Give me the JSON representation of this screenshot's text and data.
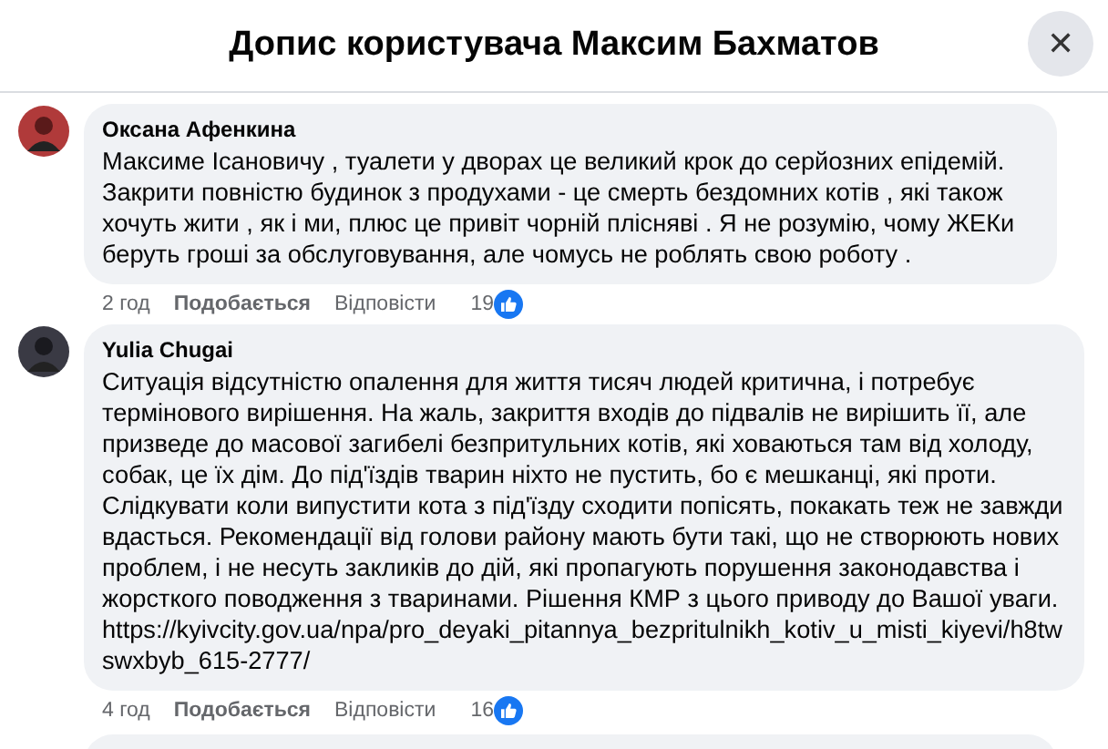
{
  "header": {
    "title": "Допис користувача Максим Бахматов",
    "close": "✕"
  },
  "comments": [
    {
      "author": "Оксана Афенкина",
      "lines": [
        "Максиме Ісановичу , туалети у дворах це великий крок до серйозних епідемій.",
        "Закрити повністю будинок з продухами - це смерть бездомних котів , які також",
        "хочуть жити , як і ми, плюс це привіт чорній плісняві . Я не розумію, чому ЖЕКи",
        "беруть гроші за обслуговування, але чомусь не роблять свою роботу ."
      ],
      "time": "2 год",
      "like": "Подобається",
      "reply": "Відповісти",
      "reactions": "19"
    },
    {
      "author": "Yulia Chugai",
      "lines": [
        "Ситуація відсутністю опалення для життя тисяч людей критична, і потребує",
        "термінового вирішення. На жаль, закриття входів до підвалів не вирішить її, але",
        "призведе до масової загибелі безпритульних котів, які ховаються там від холоду,",
        "собак, це їх дім. До під'їздів тварин ніхто не пустить, бо є мешканці, які проти.",
        "Слідкувати коли випустити кота з під'їзду сходити попісять, покакать теж не завжди",
        "вдасться. Рекомендації від голови району мають бути такі, що не створюють нових",
        "проблем, і не несуть закликів до дій, які пропагують порушення законодавства і",
        "жорсткого поводження з тваринами. Рішення КМР з цього приводу до Вашої уваги.",
        "https://kyivcity.gov.ua/npa/pro_deyaki_pitannya_bezpritulnikh_kotiv_u_misti_kiyevi/h8tw",
        "swxbyb_615-2777/"
      ],
      "time": "4 год",
      "like": "Подобається",
      "reply": "Відповісти",
      "reactions": "16"
    }
  ]
}
